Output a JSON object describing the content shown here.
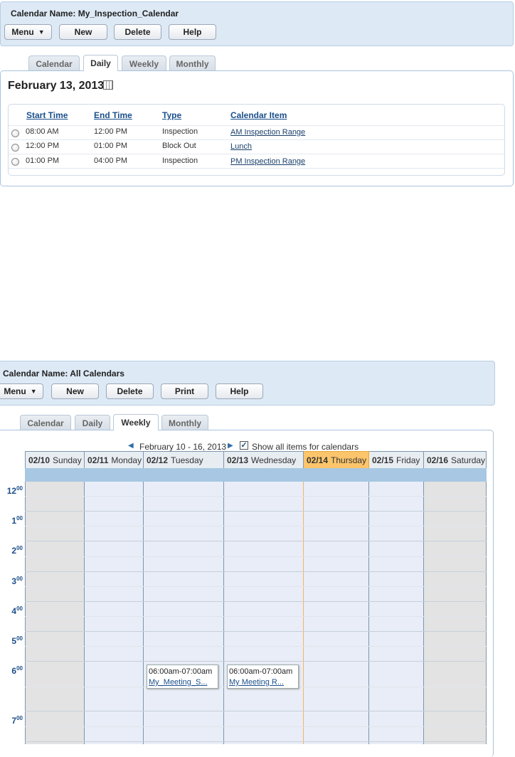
{
  "top": {
    "calendar_name": "Calendar Name: My_Inspection_Calendar",
    "buttons": {
      "menu": "Menu",
      "new": "New",
      "delete": "Delete",
      "help": "Help"
    },
    "tabs": [
      "Calendar",
      "Daily",
      "Weekly",
      "Monthly"
    ],
    "active_tab": "Daily",
    "date_title": "February 13, 2013",
    "table": {
      "headers": [
        "Start Time",
        "End Time",
        "Type",
        "Calendar Item"
      ],
      "rows": [
        {
          "start": "08:00 AM",
          "end": "12:00 PM",
          "type": "Inspection",
          "item": "AM Inspection Range"
        },
        {
          "start": "12:00 PM",
          "end": "01:00 PM",
          "type": "Block Out",
          "item": "Lunch"
        },
        {
          "start": "01:00 PM",
          "end": "04:00 PM",
          "type": "Inspection",
          "item": "PM Inspection Range"
        }
      ]
    }
  },
  "bottom": {
    "calendar_name": "Calendar Name: All Calendars",
    "buttons": {
      "menu": "Menu",
      "new": "New",
      "delete": "Delete",
      "print": "Print",
      "help": "Help"
    },
    "tabs": [
      "Calendar",
      "Daily",
      "Weekly",
      "Monthly"
    ],
    "active_tab": "Weekly",
    "range": "February 10 - 16, 2013",
    "show_all_label": "Show all items for calendars",
    "show_all_checked": true,
    "days": [
      {
        "date": "02/10",
        "name": "Sunday",
        "weekend": true
      },
      {
        "date": "02/11",
        "name": "Monday",
        "weekend": false
      },
      {
        "date": "02/12",
        "name": "Tuesday",
        "weekend": false
      },
      {
        "date": "02/13",
        "name": "Wednesday",
        "weekend": false
      },
      {
        "date": "02/14",
        "name": "Thursday",
        "weekend": false,
        "today": true
      },
      {
        "date": "02/15",
        "name": "Friday",
        "weekend": false
      },
      {
        "date": "02/16",
        "name": "Saturday",
        "weekend": true
      }
    ],
    "hours": [
      "12",
      "1",
      "2",
      "3",
      "4",
      "5",
      "6",
      "7"
    ],
    "hour_suffix": "00",
    "events": [
      {
        "time": "06:00am-07:00am",
        "title": "My_Meeting_S..."
      },
      {
        "time": "06:00am-07:00am",
        "title": "My Meeting R..."
      }
    ]
  },
  "colors": {
    "header_bg": "#dde9f5",
    "today": "#fcc56b",
    "link": "#1a4f8b",
    "allday": "#a7c7e2"
  }
}
